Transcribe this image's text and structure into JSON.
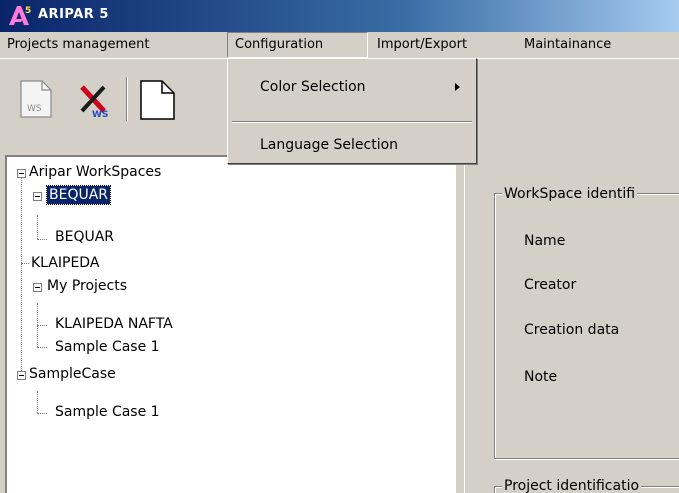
{
  "window": {
    "title": "ARIPAR 5",
    "logo_text": "A5"
  },
  "menubar": {
    "items": [
      {
        "label": "Projects management"
      },
      {
        "label": "Configuration"
      },
      {
        "label": "Import/Export"
      },
      {
        "label": "Maintainance"
      }
    ]
  },
  "toolbar": {
    "buttons": [
      {
        "icon": "new-workspace-icon",
        "text": "WS"
      },
      {
        "icon": "delete-workspace-icon",
        "text": "WS"
      },
      {
        "icon": "new-document-icon"
      }
    ]
  },
  "configuration_menu": {
    "items": [
      {
        "label": "Color Selection",
        "has_submenu": true
      },
      {
        "label": "Language Selection",
        "has_submenu": false
      }
    ]
  },
  "tree": {
    "root": "Aripar WorkSpaces",
    "nodes": [
      {
        "label": "BEQUAR",
        "selected": true,
        "expanded": true
      },
      {
        "label": "BEQUAR"
      },
      {
        "label": "KLAIPEDA"
      },
      {
        "label": "My Projects",
        "expanded": true
      },
      {
        "label": "KLAIPEDA NAFTA"
      },
      {
        "label": "Sample Case 1"
      },
      {
        "label": "SampleCase",
        "expanded": true
      },
      {
        "label": "Sample Case 1"
      }
    ]
  },
  "workspace_panel": {
    "group_title": "WorkSpace identifi",
    "fields": [
      "Name",
      "Creator",
      "Creation data",
      "Note"
    ],
    "project_group_title": "Project identificatio"
  },
  "colors": {
    "selection": "#0a246a",
    "chrome": "#d4d0c8",
    "delete_x": "#d0021b"
  }
}
